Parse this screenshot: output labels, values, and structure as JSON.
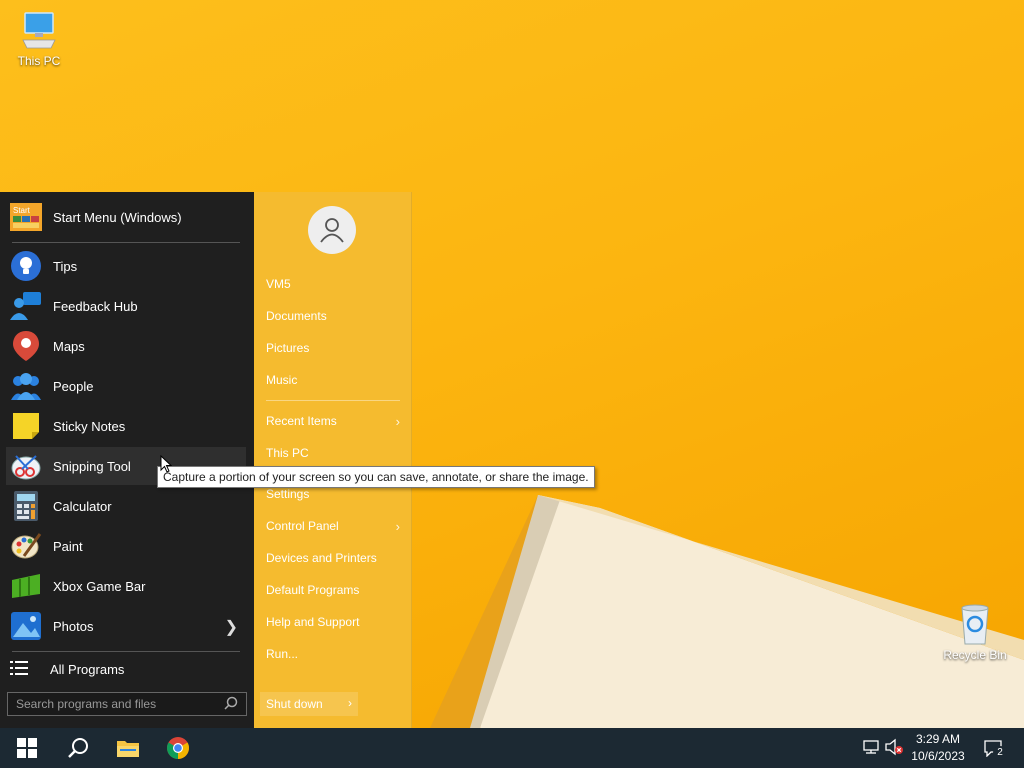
{
  "desktop": {
    "icons": [
      {
        "label": "This PC",
        "icon": "this-pc-icon"
      },
      {
        "label": "Recycle Bin",
        "icon": "recycle-bin-icon"
      }
    ]
  },
  "start_menu": {
    "pinned_header": "Start Menu (Windows)",
    "items": [
      {
        "label": "Tips",
        "icon": "tips-icon"
      },
      {
        "label": "Feedback Hub",
        "icon": "feedback-hub-icon"
      },
      {
        "label": "Maps",
        "icon": "maps-icon"
      },
      {
        "label": "People",
        "icon": "people-icon"
      },
      {
        "label": "Sticky Notes",
        "icon": "sticky-notes-icon"
      },
      {
        "label": "Snipping Tool",
        "icon": "snipping-tool-icon"
      },
      {
        "label": "Calculator",
        "icon": "calculator-icon"
      },
      {
        "label": "Paint",
        "icon": "paint-icon"
      },
      {
        "label": "Xbox Game Bar",
        "icon": "xbox-game-bar-icon"
      },
      {
        "label": "Photos",
        "icon": "photos-icon"
      }
    ],
    "all_programs": "All Programs",
    "search_placeholder": "Search programs and files",
    "right_links": [
      "VM5",
      "Documents",
      "Pictures",
      "Music",
      "Recent Items",
      "This PC",
      "Settings",
      "Control Panel",
      "Devices and Printers",
      "Default Programs",
      "Help and Support",
      "Run..."
    ],
    "shutdown_label": "Shut down"
  },
  "tooltip": "Capture a portion of your screen so you can save, annotate, or share the image.",
  "taskbar": {
    "time": "3:29 AM",
    "date": "10/6/2023",
    "notification_count": "2"
  },
  "colors": {
    "start_left": "#1f1f1f",
    "start_right": "#f5bb2f",
    "taskbar": "#1c2933",
    "wallpaper": "#fcb510"
  }
}
